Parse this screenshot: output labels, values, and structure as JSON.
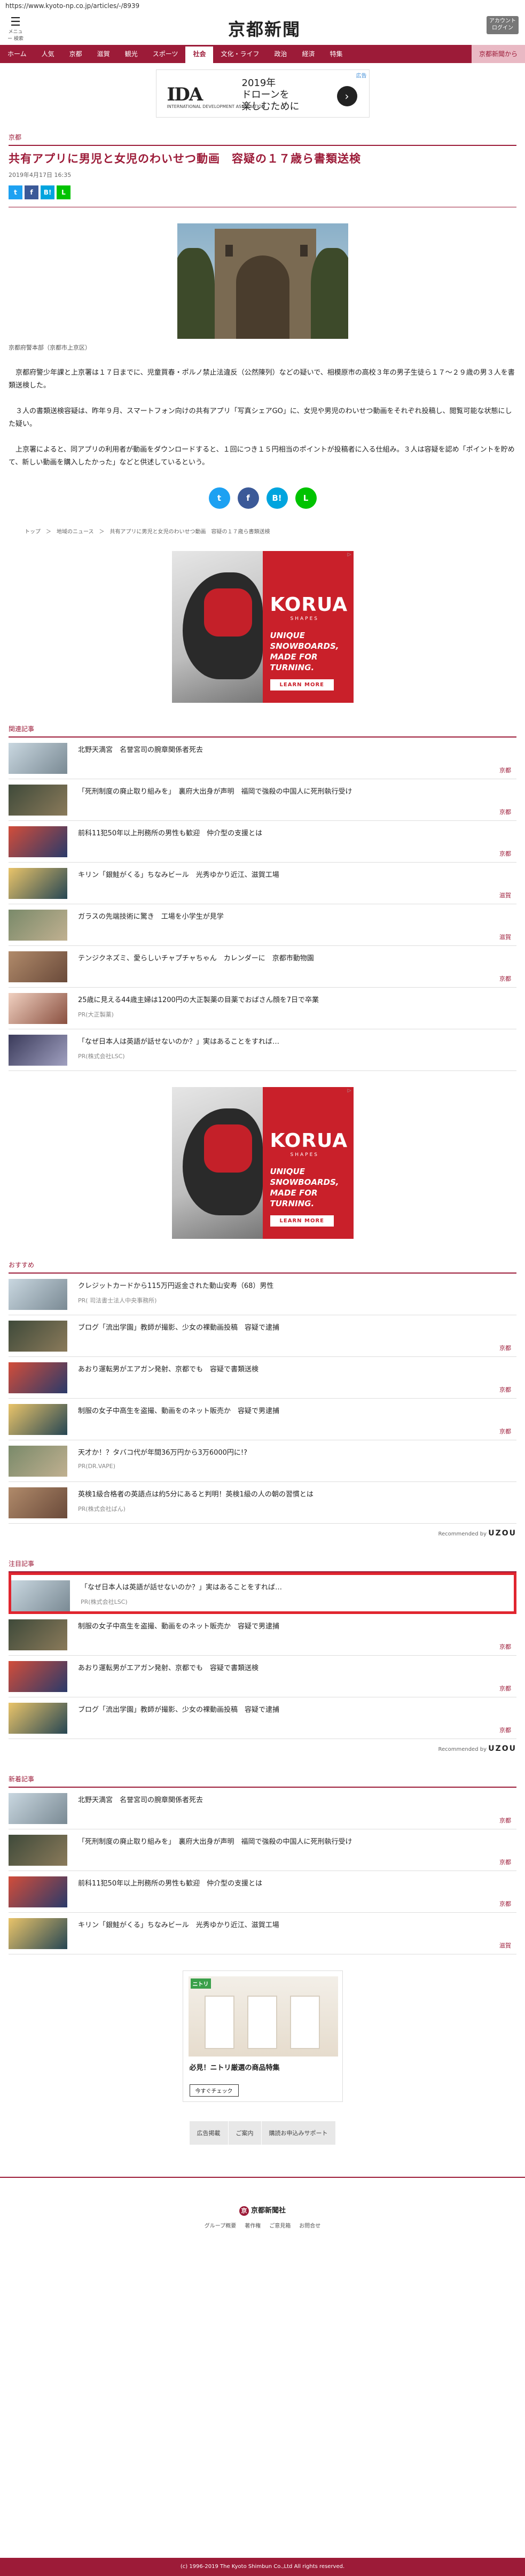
{
  "url": "https://www.kyoto-np.co.jp/articles/-/8939",
  "header": {
    "menu_icon": "hamburger-icon",
    "menu_label": "メニュー  検索",
    "logo": "京都新聞",
    "login_label": "アカウント ログイン"
  },
  "nav": [
    "ホーム",
    "人気",
    "京都",
    "滋賀",
    "観光",
    "スポーツ",
    "社会",
    "文化・ライフ",
    "政治",
    "経済",
    "特集",
    "京都新聞から"
  ],
  "nav_active": "社会",
  "top_ad": {
    "brand": "IDA",
    "brand_sub": "INTERNATIONAL DEVELOPMENT ASSOCIATION",
    "line1": "2019年",
    "line2": "ドローンを",
    "line3": "楽しむために",
    "ad_label": "広告"
  },
  "article": {
    "category": "京都",
    "headline": "共有アプリに男児と女児のわいせつ動画　容疑の１７歳ら書類送検",
    "date": "2019年4月17日 16:35",
    "caption": "京都府警本部（京都市上京区）",
    "paragraphs": [
      "京都府警少年課と上京署は１７日までに、児童買春・ポルノ禁止法違反（公然陳列）などの疑いで、相模原市の高校３年の男子生徒ら１７～２９歳の男３人を書類送検した。",
      "３人の書類送検容疑は、昨年９月、スマートフォン向けの共有アプリ「写真シェアGO」に、女児や男児のわいせつ動画をそれぞれ投稿し、閲覧可能な状態にした疑い。",
      "上京署によると、同アプリの利用者が動画をダウンロードすると、１回につき１５円相当のポイントが投稿者に入る仕組み。３人は容疑を認め「ポイントを貯めて、新しい動画を購入したかった」などと供述しているという。"
    ],
    "breadcrumb": "トップ　＞　地域のニュース　＞　共有アプリに男児と女児のわいせつ動画　容疑の１７歳ら書類送検"
  },
  "korua_ad": {
    "brand": "KORUA",
    "sub": "SHAPES",
    "tag1": "UNIQUE",
    "tag2": "SNOWBOARDS,",
    "tag3": "MADE FOR",
    "tag4": "TURNING.",
    "cta": "LEARN MORE"
  },
  "related": {
    "title": "関連記事",
    "items": [
      {
        "title": "北野天満宮　名誉宮司の腕章関係者死去",
        "tag": "京都"
      },
      {
        "title": "「死刑制度の廃止取り組みを」　裏府大出身が声明　福岡で強殺の中国人に死刑執行受け",
        "tag": "京都"
      },
      {
        "title": "前科11犯50年以上刑務所の男性も歓迎　仲介型の支援とは",
        "tag": "京都"
      },
      {
        "title": "キリン「銀鮭がくる」ちなみビール　光秀ゆかり近江、滋賀工場",
        "tag": "滋賀"
      },
      {
        "title": "ガラスの先端技術に驚き　工場を小学生が見学",
        "tag": "滋賀"
      },
      {
        "title": "テンジクネズミ、愛らしいチャプチャちゃん　カレンダーに　京都市動物園",
        "tag": "京都"
      },
      {
        "title": "25歳に見える44歳主婦は1200円の大正製薬の目薬でおばさん顔を7日で卒業",
        "pr": "PR(大正製薬)"
      },
      {
        "title": "「なぜ日本人は英語が話せないのか？」実はあることをすれば…",
        "pr": "PR(株式会社LSC)"
      }
    ]
  },
  "recommend": {
    "title": "おすすめ",
    "items": [
      {
        "title": "クレジットカードから115万円返金された動山安寿（68）男性",
        "pr": "PR( 司法書士法人中央事務所)"
      },
      {
        "title": "ブログ「流出学園」教師が撮影、少女の裸動画投稿　容疑で逮捕",
        "tag": "京都"
      },
      {
        "title": "あおり運転男がエアガン発射、京都でも　容疑で書類送検",
        "tag": "京都"
      },
      {
        "title": "制服の女子中高生を盗撮、動画をのネット販売か　容疑で男逮捕",
        "tag": "京都"
      },
      {
        "title": "天才か！？タバコ代が年間36万円から3万6000円に!?",
        "pr": "PR(DR.VAPE)"
      },
      {
        "title": "英検1級合格者の英語点は約5分にあると判明！英検1級の人の朝の習慣とは",
        "pr": "PR(株式会社ばん)"
      }
    ],
    "powered": "Recommended by",
    "powered_brand": "UZOU"
  },
  "notable": {
    "title": "注目記事",
    "items": [
      {
        "title": "「なぜ日本人は英語が話せないのか？」実はあることをすれば…",
        "pr": "PR(株式会社LSC)",
        "highlight": true
      },
      {
        "title": "制服の女子中高生を盗撮、動画をのネット販売か　容疑で男逮捕",
        "tag": "京都"
      },
      {
        "title": "あおり運転男がエアガン発射、京都でも　容疑で書類送検",
        "tag": "京都"
      },
      {
        "title": "ブログ「流出学園」教師が撮影、少女の裸動画投稿　容疑で逮捕",
        "tag": "京都"
      }
    ],
    "powered": "Recommended by",
    "powered_brand": "UZOU"
  },
  "latest": {
    "title": "新着記事",
    "items": [
      {
        "title": "北野天満宮　名誉宮司の腕章関係者死去",
        "tag": "京都"
      },
      {
        "title": "「死刑制度の廃止取り組みを」　裏府大出身が声明　福岡で強殺の中国人に死刑執行受け",
        "tag": "京都"
      },
      {
        "title": "前科11犯50年以上刑務所の男性も歓迎　仲介型の支援とは",
        "tag": "京都"
      },
      {
        "title": "キリン「銀鮭がくる」ちなみビール　光秀ゆかり近江、滋賀工場",
        "tag": "滋賀"
      }
    ]
  },
  "nitori_ad": {
    "logo": "ニトリ",
    "line1": "必見！ニトリ厳選の商品特集",
    "line2": "",
    "cta": "今すぐチェック"
  },
  "footer": {
    "links": [
      "広告掲載",
      "ご案内",
      "購読お申込みサポート"
    ],
    "logo": "京都新聞社",
    "sub": [
      "グループ概要",
      "著作権",
      "ご意見箱",
      "お問合せ"
    ],
    "copyright": "(c) 1996-2019 The Kyoto Shimbun Co.,Ltd All rights reserved."
  }
}
